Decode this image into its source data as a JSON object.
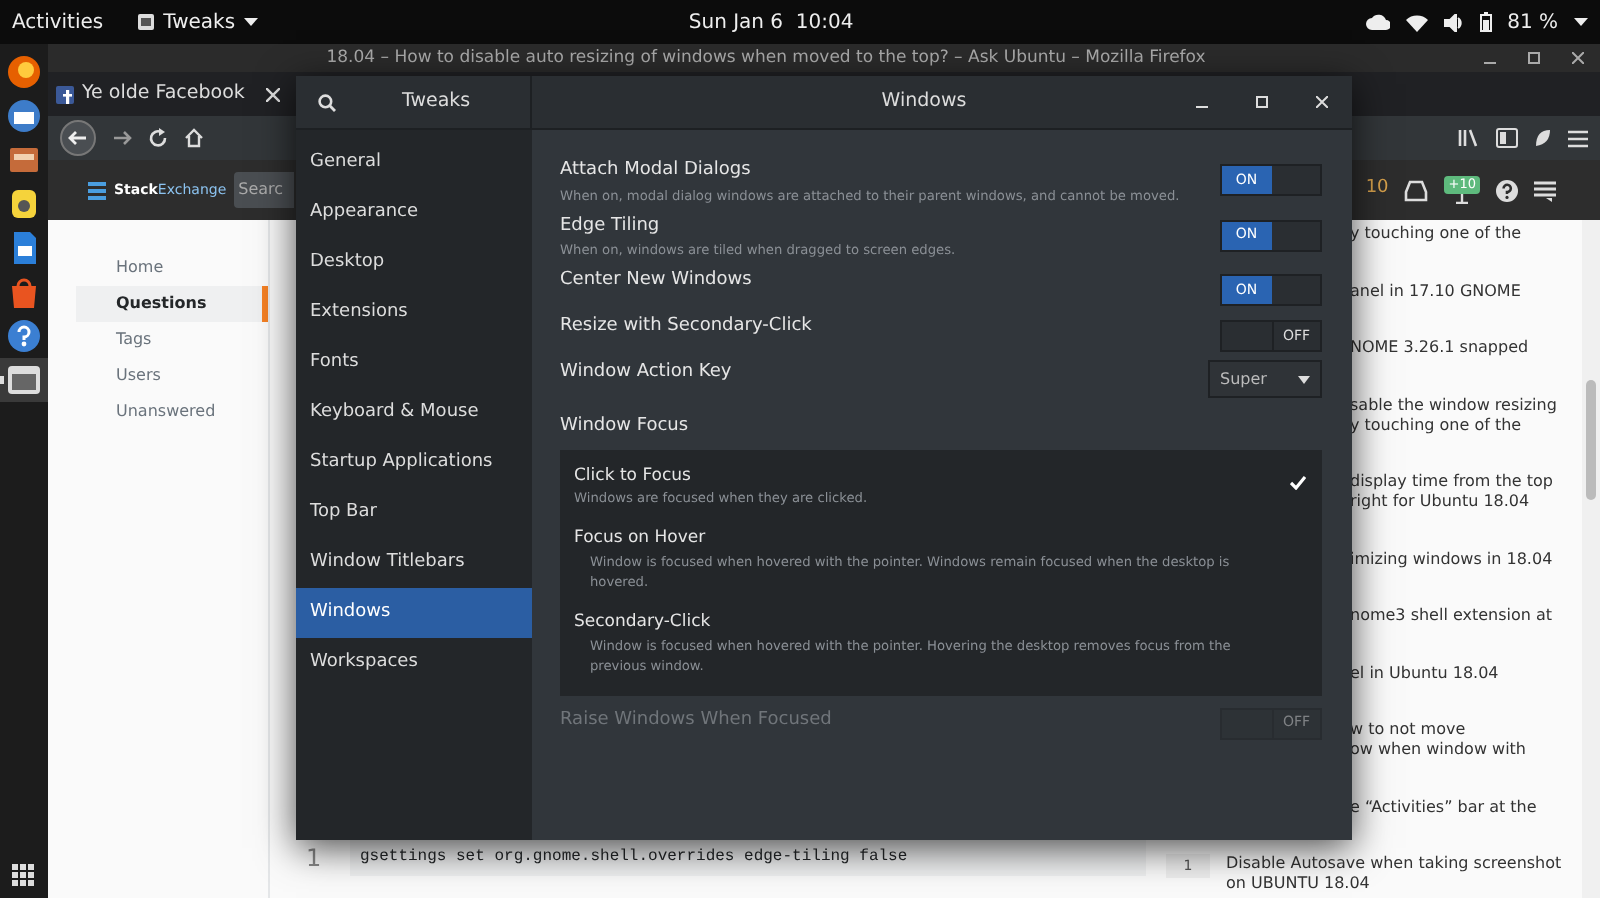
{
  "top_bar": {
    "activities": "Activities",
    "app_menu": "Tweaks",
    "clock": "Sun Jan 6  10:04",
    "battery": "81 %"
  },
  "dock": {
    "items": [
      {
        "kind": "browser",
        "active": false
      },
      {
        "kind": "mail",
        "active": false
      },
      {
        "kind": "files",
        "active": false
      },
      {
        "kind": "music",
        "active": false
      },
      {
        "kind": "document",
        "active": false
      },
      {
        "kind": "store",
        "active": false
      },
      {
        "kind": "help",
        "active": false
      },
      {
        "kind": "tweaks",
        "active": true
      }
    ]
  },
  "browser": {
    "title": "18.04 – How to disable auto resizing of windows when moved to the top? – Ask Ubuntu – Mozilla Firefox",
    "tabs": [
      {
        "label": "Ye olde Facebook",
        "selected": false
      }
    ],
    "site": {
      "logo_first": "Stack",
      "logo_second": "Exchange",
      "search_placeholder": "Searc",
      "reputation": "10",
      "badge": "+10"
    },
    "nav": [
      {
        "label": "Home",
        "selected": false
      },
      {
        "label": "Questions",
        "selected": true
      },
      {
        "label": "Tags",
        "selected": false
      },
      {
        "label": "Users",
        "selected": false
      },
      {
        "label": "Unanswered",
        "selected": false
      }
    ],
    "related": [
      {
        "text": "y touching one of the"
      },
      {
        "text": "anel in 17.10 GNOME"
      },
      {
        "text": "NOME 3.26.1 snapped"
      },
      {
        "text": "sable the window resizing\ny touching one of the"
      },
      {
        "text": "display time from the top\nright for Ubuntu 18.04"
      },
      {
        "text": "imizing windows in 18.04"
      },
      {
        "text": "nome3 shell extension at"
      },
      {
        "text": "el in Ubuntu 18.04"
      },
      {
        "text": "w to not move\now when window with"
      },
      {
        "text": "e “Activities” bar at the"
      },
      {
        "vote": "1",
        "text": "Disable Autosave when taking screenshot\non UBUNTU 18.04"
      }
    ],
    "code": {
      "line_number": "1",
      "text": "gsettings set org.gnome.shell.overrides edge-tiling false"
    }
  },
  "tweaks": {
    "app_title": "Tweaks",
    "page_title": "Windows",
    "sidebar": [
      {
        "label": "General",
        "selected": false
      },
      {
        "label": "Appearance",
        "selected": false
      },
      {
        "label": "Desktop",
        "selected": false
      },
      {
        "label": "Extensions",
        "selected": false
      },
      {
        "label": "Fonts",
        "selected": false
      },
      {
        "label": "Keyboard & Mouse",
        "selected": false
      },
      {
        "label": "Startup Applications",
        "selected": false
      },
      {
        "label": "Top Bar",
        "selected": false
      },
      {
        "label": "Window Titlebars",
        "selected": false
      },
      {
        "label": "Windows",
        "selected": true
      },
      {
        "label": "Workspaces",
        "selected": false
      }
    ],
    "settings": [
      {
        "kind": "switch",
        "label": "Attach Modal Dialogs",
        "description": "When on, modal dialog windows are attached to their parent windows, and cannot be moved.",
        "on": true,
        "state_label": "ON"
      },
      {
        "kind": "switch",
        "label": "Edge Tiling",
        "description": "When on, windows are tiled when dragged to screen edges.",
        "on": true,
        "state_label": "ON"
      },
      {
        "kind": "switch",
        "label": "Center New Windows",
        "on": true,
        "state_label": "ON"
      },
      {
        "kind": "switch",
        "label": "Resize with Secondary-Click",
        "on": false,
        "state_label": "OFF"
      },
      {
        "kind": "dropdown",
        "label": "Window Action Key",
        "value": "Super"
      }
    ],
    "focus": {
      "heading": "Window Focus",
      "options": [
        {
          "label": "Click to Focus",
          "description": "Windows are focused when they are clicked.",
          "selected": true
        },
        {
          "label": "Focus on Hover",
          "description": "Window is focused when hovered with the pointer. Windows remain focused when the desktop is hovered.",
          "selected": false
        },
        {
          "label": "Secondary-Click",
          "description": "Window is focused when hovered with the pointer. Hovering the desktop removes focus from the previous window.",
          "selected": false
        }
      ]
    },
    "bottom_setting": {
      "kind": "switch",
      "label": "Raise Windows When Focused",
      "on": false,
      "disabled": true,
      "state_label": "OFF"
    }
  }
}
